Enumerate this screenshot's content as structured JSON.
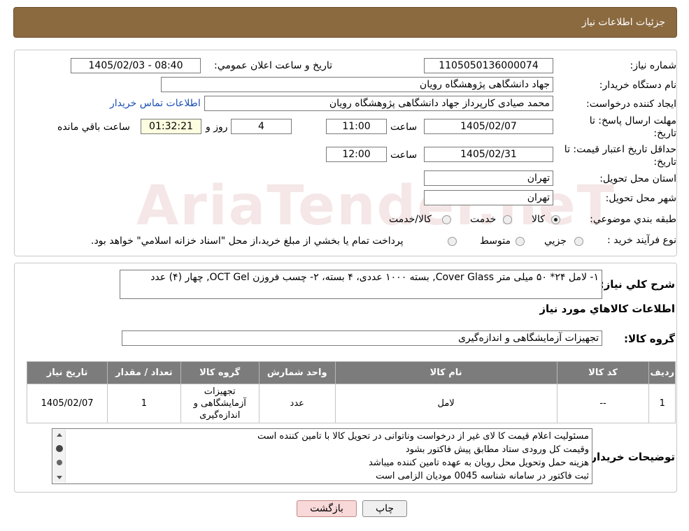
{
  "header": {
    "title": "جزئيات اطلاعات نياز"
  },
  "watermark": "AriaTender.neT",
  "form": {
    "need_number_label": "شماره نياز:",
    "need_number": "1105050136000074",
    "announce_label": "تاريخ و ساعت اعلان عمومي:",
    "announce_value": "1405/02/03 - 08:40",
    "buyer_org_label": "نام دستگاه خريدار:",
    "buyer_org": "جهاد دانشگاهی پژوهشگاه رویان",
    "creator_label": "ايجاد كننده درخواست:",
    "creator": "محمد صیادی کارپرداز جهاد دانشگاهی پژوهشگاه رویان",
    "contact_link": "اطلاعات تماس خريدار",
    "reply_deadline_label_1": "مهلت ارسال پاسخ: تا",
    "reply_deadline_label_2": "تاريخ:",
    "reply_date": "1405/02/07",
    "time_label": "ساعت",
    "reply_time": "11:00",
    "days_value": "4",
    "days_label": "روز و",
    "remaining_time": "01:32:21",
    "remaining_label": "ساعت باقي مانده",
    "validity_label_1": "حداقل تاريخ اعتبار قيمت: تا",
    "validity_label_2": "تاريخ:",
    "validity_date": "1405/02/31",
    "validity_time": "12:00",
    "province_label": "استان محل تحويل:",
    "province": "تهران",
    "city_label": "شهر محل تحويل:",
    "city": "تهران",
    "category_label": "طبقه بندي موضوعي:",
    "category_options": [
      "كالا",
      "خدمت",
      "كالا/خدمت"
    ],
    "category_selected": "كالا",
    "process_label": "نوع فرآيند خريد :",
    "process_options": [
      "جزيي",
      "متوسط"
    ],
    "process_note": "پرداخت تمام يا بخشي از مبلغ خريد،از محل \"اسناد خزانه اسلامي\" خواهد بود."
  },
  "summary": {
    "label": "شرح كلي نياز:",
    "text": "۱- لامل ۲۴* ۵۰ میلی متر Cover Glass,  بسته ۱۰۰۰ عددی، ۴ بسته، ۲- چسب فروزن OCT Gel,  چهار (۴) عدد"
  },
  "goods_info_title": "اطلاعات كالاهاي مورد نياز",
  "goods_group": {
    "label": "گروه كالا:",
    "value": "تجهیزات آزمایشگاهی و اندازه‌گیری"
  },
  "table": {
    "headers": [
      "رديف",
      "كد كالا",
      "نام كالا",
      "واحد شمارش",
      "گروه كالا",
      "تعداد / مقدار",
      "تاريخ نياز"
    ],
    "rows": [
      {
        "row": "1",
        "code": "--",
        "name": "لامل",
        "unit": "عدد",
        "group_l1": "تجهیزات",
        "group_l2": "آزمایشگاهی و",
        "group_l3": "اندازه‌گیری",
        "qty": "1",
        "date": "1405/02/07"
      }
    ]
  },
  "buyer_notes": {
    "label": "توضيحات خريدار:",
    "lines": [
      "مسئولیت اعلام قیمت کا لای  غیر از درخواست وناتوانی در تحویل کالا با تامین کننده است",
      "وقیمت کل ورودی ستاد مطابق پیش فاکتور بشود",
      "هزینه حمل وتحویل محل رویان به عهده تامین کننده میباشد",
      "ثبت فاکتور در سامانه  شناسه 0045 مودیان الزامی است"
    ]
  },
  "buttons": {
    "print": "چاپ",
    "back": "بازگشت"
  }
}
